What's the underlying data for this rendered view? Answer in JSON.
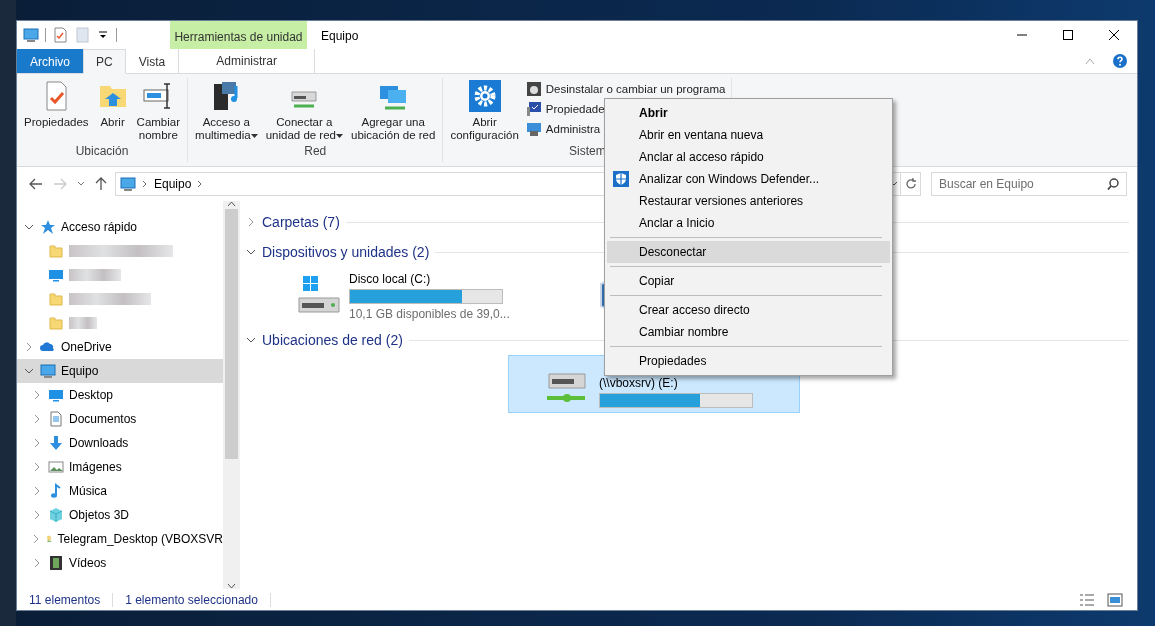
{
  "window": {
    "title": "Equipo",
    "context_tab_header": "Herramientas de unidad"
  },
  "tabs": [
    {
      "label": "Archivo",
      "kind": "file",
      "selected": false
    },
    {
      "label": "PC",
      "kind": "normal",
      "selected": true
    },
    {
      "label": "Vista",
      "kind": "normal",
      "selected": false
    },
    {
      "label": "Administrar",
      "kind": "context",
      "selected": false
    }
  ],
  "ribbon": {
    "groups": [
      {
        "label": "Ubicación",
        "large": [
          {
            "kind": "properties",
            "label": "Propiedades",
            "dropdown": false
          },
          {
            "kind": "open",
            "label": "Abrir",
            "dropdown": false
          },
          {
            "kind": "rename",
            "label": "Cambiar\nnombre",
            "dropdown": false
          }
        ]
      },
      {
        "label": "Red",
        "large": [
          {
            "kind": "media",
            "label": "Acceso a\nmultimedia",
            "dropdown": true
          },
          {
            "kind": "netdrive",
            "label": "Conectar a\nunidad de red",
            "dropdown": true
          },
          {
            "kind": "netlocation",
            "label": "Agregar una\nubicación de red",
            "dropdown": false
          }
        ]
      },
      {
        "label": "Sistem",
        "large": [
          {
            "kind": "settings",
            "label": "Abrir\nconfiguración",
            "dropdown": false
          }
        ],
        "small": [
          {
            "kind": "uninstall",
            "label": "Desinstalar o cambiar un programa"
          },
          {
            "kind": "sysprops",
            "label": "Propiedade"
          },
          {
            "kind": "manage",
            "label": "Administra"
          }
        ]
      }
    ]
  },
  "address": {
    "path": [
      "Equipo"
    ],
    "search_placeholder": "Buscar en Equipo"
  },
  "tree": [
    {
      "kind": "star",
      "label": "Acceso rápido",
      "expanded": true,
      "selected": false,
      "children": [
        {
          "kind": "folder",
          "selected": false
        },
        {
          "kind": "desktop",
          "selected": false
        },
        {
          "kind": "folder",
          "selected": false
        },
        {
          "kind": "folder",
          "selected": false
        }
      ]
    },
    {
      "kind": "cloud",
      "label": "OneDrive",
      "expanded": false,
      "selected": false
    },
    {
      "kind": "computer",
      "label": "Equipo",
      "expanded": true,
      "selected": true,
      "children": [
        {
          "kind": "desktop",
          "label": "Desktop",
          "expanded": false,
          "selected": false
        },
        {
          "kind": "documents",
          "label": "Documentos",
          "expanded": false,
          "selected": false
        },
        {
          "kind": "download",
          "label": "Downloads",
          "expanded": false,
          "selected": false
        },
        {
          "kind": "images",
          "label": "Imágenes",
          "expanded": false,
          "selected": false
        },
        {
          "kind": "music",
          "label": "Música",
          "expanded": false,
          "selected": false
        },
        {
          "kind": "cube",
          "label": "Objetos 3D",
          "expanded": false,
          "selected": false
        },
        {
          "kind": "netfolder",
          "label": "Telegram_Desktop (VBOXSVR",
          "expanded": false,
          "selected": false
        },
        {
          "kind": "video",
          "label": "Vídeos",
          "expanded": false,
          "selected": false
        }
      ]
    }
  ],
  "sections": [
    {
      "label": "Carpetas (7)",
      "expanded": false
    },
    {
      "label": "Dispositivos y unidades (2)",
      "expanded": true,
      "drives": [
        {
          "kind": "local",
          "label": "Disco local (C:)",
          "level": 0.74,
          "detail": "10,1 GB disponibles de 39,0...",
          "selected": false
        },
        {
          "kind": "virtualbox",
          "selected": false
        }
      ]
    },
    {
      "label": "Ubicaciones de red (2)",
      "expanded": true,
      "drives": [
        {
          "kind": "network",
          "label": "(\\\\vboxsrv) (E:)",
          "level": 0.66,
          "selected": true
        }
      ]
    }
  ],
  "context_menu": [
    {
      "kind": "item",
      "label": "Abrir",
      "default": true,
      "selected": false
    },
    {
      "kind": "item",
      "label": "Abrir en ventana nueva",
      "default": false,
      "selected": false
    },
    {
      "kind": "item",
      "label": "Anclar al acceso rápido",
      "default": false,
      "selected": false
    },
    {
      "kind": "shield",
      "label": "Analizar con Windows Defender...",
      "default": false,
      "selected": false
    },
    {
      "kind": "item",
      "label": "Restaurar versiones anteriores",
      "default": false,
      "selected": false
    },
    {
      "kind": "item",
      "label": "Anclar a Inicio",
      "default": false,
      "selected": false
    },
    {
      "kind": "separator"
    },
    {
      "kind": "item",
      "label": "Desconectar",
      "default": false,
      "selected": true
    },
    {
      "kind": "separator"
    },
    {
      "kind": "item",
      "label": "Copiar",
      "default": false,
      "selected": false
    },
    {
      "kind": "separator"
    },
    {
      "kind": "item",
      "label": "Crear acceso directo",
      "default": false,
      "selected": false
    },
    {
      "kind": "item",
      "label": "Cambiar nombre",
      "default": false,
      "selected": false
    },
    {
      "kind": "separator"
    },
    {
      "kind": "item",
      "label": "Propiedades",
      "default": false,
      "selected": false
    }
  ],
  "status_bar": {
    "count": "11 elementos",
    "selection": "1 elemento seleccionado"
  }
}
